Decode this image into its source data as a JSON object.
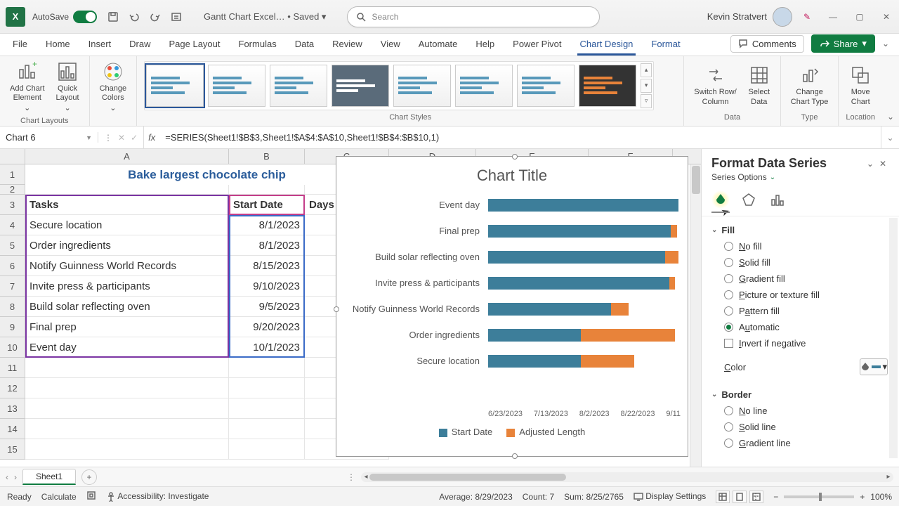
{
  "titlebar": {
    "app_initial": "X",
    "autosave_label": "AutoSave",
    "doc_name": "Gantt Chart Excel…",
    "save_state": "Saved",
    "search_placeholder": "Search",
    "user_name": "Kevin Stratvert"
  },
  "ribbon_tabs": [
    "File",
    "Home",
    "Insert",
    "Draw",
    "Page Layout",
    "Formulas",
    "Data",
    "Review",
    "View",
    "Automate",
    "Help",
    "Power Pivot",
    "Chart Design",
    "Format"
  ],
  "active_tab": "Chart Design",
  "comments_label": "Comments",
  "share_label": "Share",
  "ribbon": {
    "group_layouts": "Chart Layouts",
    "add_element": "Add Chart\nElement",
    "quick_layout": "Quick\nLayout",
    "change_colors": "Change\nColors",
    "group_styles": "Chart Styles",
    "group_data": "Data",
    "switch_rowcol": "Switch Row/\nColumn",
    "select_data": "Select\nData",
    "group_type": "Type",
    "change_type": "Change\nChart Type",
    "group_location": "Location",
    "move_chart": "Move\nChart"
  },
  "namebox": "Chart 6",
  "formula": "=SERIES(Sheet1!$B$3,Sheet1!$A$4:$A$10,Sheet1!$B$4:$B$10,1)",
  "columns": [
    "A",
    "B",
    "C",
    "D",
    "E",
    "F"
  ],
  "row_numbers": [
    "1",
    "2",
    "3",
    "4",
    "5",
    "6",
    "7",
    "8",
    "9",
    "10",
    "11",
    "12",
    "13",
    "14",
    "15"
  ],
  "title_cell": "Bake largest chocolate chip",
  "headers": {
    "tasks": "Tasks",
    "start": "Start Date",
    "days": "Days"
  },
  "rows": [
    {
      "task": "Secure location",
      "date": "8/1/2023"
    },
    {
      "task": "Order ingredients",
      "date": "8/1/2023"
    },
    {
      "task": "Notify Guinness  World Records",
      "date": "8/15/2023"
    },
    {
      "task": "Invite press & participants",
      "date": "9/10/2023"
    },
    {
      "task": "Build solar reflecting oven",
      "date": "9/5/2023"
    },
    {
      "task": "Final prep",
      "date": "9/20/2023"
    },
    {
      "task": "Event day",
      "date": "10/1/2023"
    }
  ],
  "chart": {
    "title": "Chart Title",
    "legend_a": "Start Date",
    "legend_b": "Adjusted Length",
    "xaxis": [
      "6/23/2023",
      "7/13/2023",
      "8/2/2023",
      "8/22/2023",
      "9/11"
    ]
  },
  "chart_data": {
    "type": "bar",
    "orientation": "horizontal",
    "stacked": true,
    "title": "Chart Title",
    "xlabel": "",
    "ylabel": "",
    "categories": [
      "Event day",
      "Final prep",
      "Build solar reflecting oven",
      "Invite press & participants",
      "Notify Guinness  World Records",
      "Order ingredients",
      "Secure location"
    ],
    "series": [
      {
        "name": "Start Date",
        "color": "#3d7e9a",
        "values_dates": [
          "10/1/2023",
          "9/20/2023",
          "9/5/2023",
          "9/10/2023",
          "8/15/2023",
          "8/1/2023",
          "8/1/2023"
        ]
      },
      {
        "name": "Adjusted Length",
        "color": "#e8833a",
        "values_days_est": [
          1,
          3,
          14,
          3,
          14,
          45,
          30
        ]
      }
    ],
    "x_tick_labels": [
      "6/23/2023",
      "7/13/2023",
      "8/2/2023",
      "8/22/2023",
      "9/11"
    ],
    "note": "Start Date bars span from axis origin (≈6/23/2023) to the start date; Adjusted Length stacks after Start Date. Day values are estimated from bar pixel lengths."
  },
  "sidepane": {
    "title": "Format Data Series",
    "subtitle": "Series Options",
    "section_fill": "Fill",
    "fill_options": [
      "No fill",
      "Solid fill",
      "Gradient fill",
      "Picture or texture fill",
      "Pattern fill",
      "Automatic"
    ],
    "fill_selected": "Automatic",
    "invert_label": "Invert if negative",
    "color_label": "Color",
    "section_border": "Border",
    "border_options": [
      "No line",
      "Solid line",
      "Gradient line"
    ]
  },
  "sheet_tab": "Sheet1",
  "statusbar": {
    "ready": "Ready",
    "calc": "Calculate",
    "access": "Accessibility: Investigate",
    "avg": "Average: 8/29/2023",
    "count": "Count: 7",
    "sum": "Sum: 8/25/2765",
    "display": "Display Settings",
    "zoom": "100%"
  }
}
